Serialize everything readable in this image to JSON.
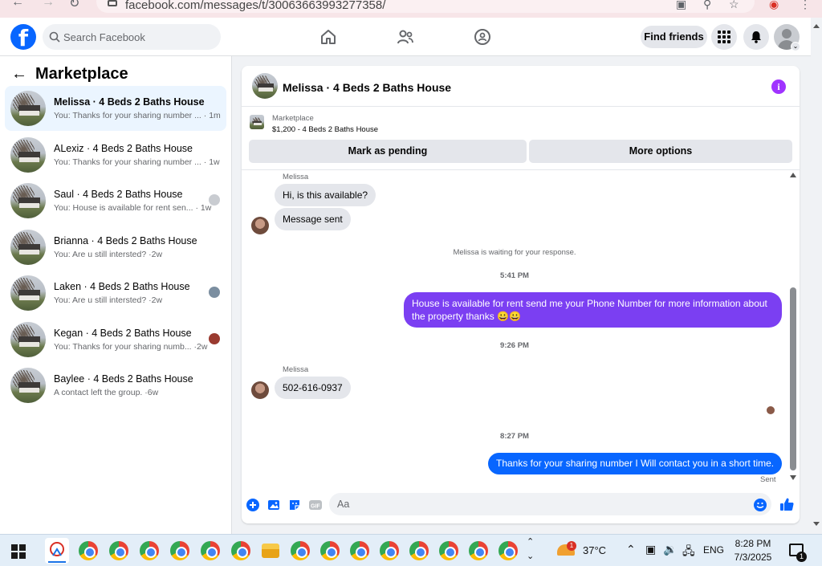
{
  "browser": {
    "url": "facebook.com/messages/t/30063663993277358/"
  },
  "topbar": {
    "search_placeholder": "Search Facebook",
    "find_friends_label": "Find friends"
  },
  "sidebar": {
    "title": "Marketplace",
    "conversations": [
      {
        "name": "Melissa · 4 Beds 2 Baths House",
        "snippet": "You: Thanks for your sharing number ...",
        "time": "1m"
      },
      {
        "name": "ALexiz · 4 Beds 2 Baths House",
        "snippet": "You: Thanks for your sharing number ...",
        "time": "1w"
      },
      {
        "name": "Saul · 4 Beds 2 Baths House",
        "snippet": "You: House is available for rent sen...",
        "time": "1w"
      },
      {
        "name": "Brianna · 4 Beds 2 Baths House",
        "snippet": "You: Are u still intersted? ·",
        "time": "2w"
      },
      {
        "name": "Laken · 4 Beds 2 Baths House",
        "snippet": "You: Are u still intersted? ·",
        "time": "2w"
      },
      {
        "name": "Kegan · 4 Beds 2 Baths House",
        "snippet": "You: Thanks for your sharing numb... ·",
        "time": "2w"
      },
      {
        "name": "Baylee · 4 Beds 2 Baths House",
        "snippet": "A contact left the group. ·",
        "time": "6w"
      }
    ]
  },
  "chat": {
    "title": "Melissa · 4 Beds 2 Baths House",
    "listing": {
      "label": "Marketplace",
      "price_title": "$1,200 - 4 Beds 2 Baths House",
      "mark_pending_label": "Mark as pending",
      "more_options_label": "More options"
    },
    "messages": {
      "sender1": "Melissa",
      "msg1": "Hi, is this available?",
      "msg2": "Message sent",
      "waiting_note": "Melissa is waiting for your response.",
      "time1": "5:41 PM",
      "out1": "House is available for rent send me your Phone Number for more information about the property thanks 😀😀",
      "time2": "9:26 PM",
      "sender2": "Melissa",
      "msg3": "502-616-0937",
      "time3": "8:27 PM",
      "out2": "Thanks for your sharing number I Will contact you in a short time.",
      "sent_label": "Sent"
    },
    "composer_placeholder": "Aa"
  },
  "taskbar": {
    "temperature": "37°C",
    "language": "ENG",
    "time": "8:28 PM",
    "date": "7/3/2025",
    "weather_badge": "1",
    "notif_count": "1"
  },
  "colors": {
    "fb_blue": "#0866ff",
    "outgoing_purple": "#7b3ff2",
    "info_purple": "#a033ff"
  }
}
